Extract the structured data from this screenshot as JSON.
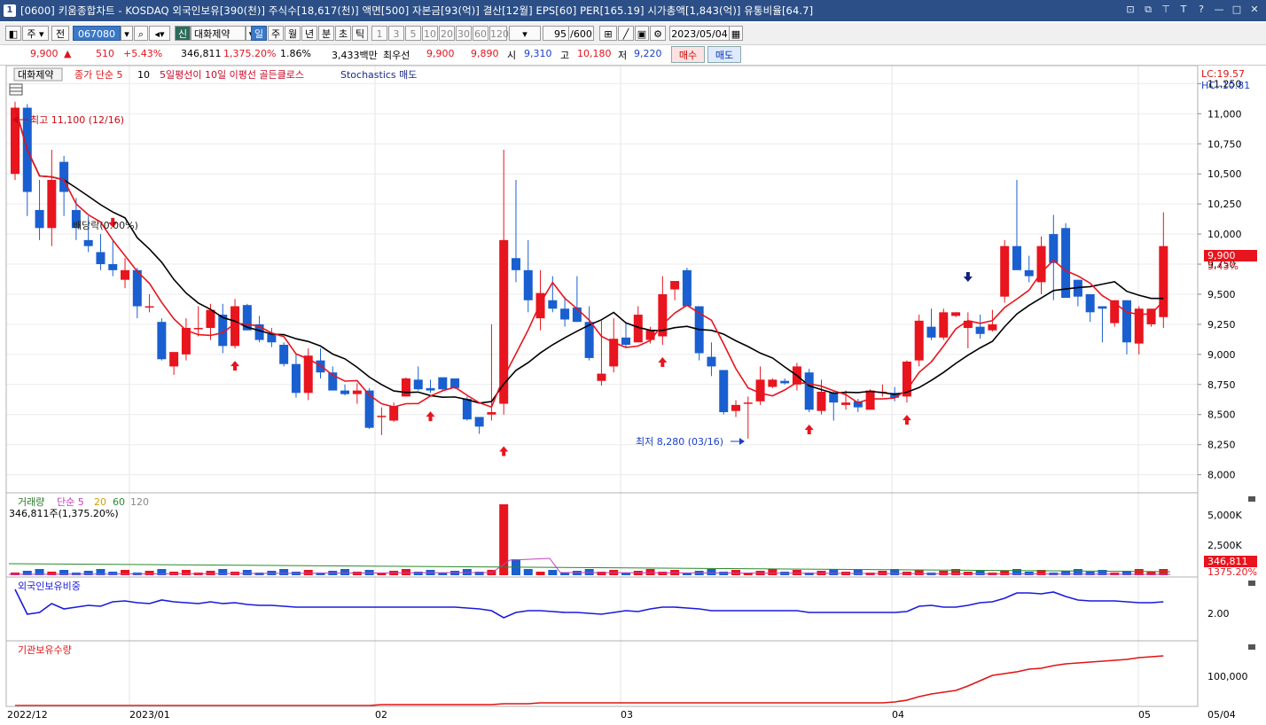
{
  "window": {
    "number": "1",
    "title": "[0600] 키움종합차트 - KOSDAQ 외국인보유[390(천)] 주식수[18,617(천)] 액면[500] 자본금[93(억)] 결산[12월] EPS[60] PER[165.19] 시가총액[1,843(억)] 유통비율[64.7]",
    "controls": [
      "⊡",
      "⧉",
      "⊤",
      "T",
      "?",
      "—",
      "□",
      "✕"
    ]
  },
  "toolbar": {
    "period_label": "주",
    "prev_label": "전",
    "code": "067080",
    "stock_tag": "신",
    "stock_name": "대화제약",
    "intervals": [
      "일",
      "주",
      "월",
      "년",
      "분",
      "초",
      "틱"
    ],
    "selected_interval": "일",
    "minute_options": [
      "1",
      "3",
      "5",
      "10",
      "20",
      "30",
      "60",
      "120"
    ],
    "count": "95",
    "count_max": "/600",
    "date": "2023/05/04"
  },
  "quote": {
    "price": "9,900",
    "change": "510",
    "change_pct": "+5.43%",
    "volume": "346,811",
    "volume_ratio": "1,375.20%",
    "turnover": "1.86%",
    "amount": "3,433백만",
    "best_label": "최우선",
    "ask": "9,900",
    "bid": "9,890",
    "open_label": "시",
    "open": "9,310",
    "high_label": "고",
    "high": "10,180",
    "low_label": "저",
    "low": "9,220",
    "buy_label": "매수",
    "sell_label": "매도"
  },
  "price_panel": {
    "name_tag": "대화제약",
    "legend_close": "종가 단순 5",
    "legend_ma10": "10",
    "legend_cross": "5일평선이 10일 이평선 골든클로스",
    "legend_stoch": "Stochastics 매도",
    "lc": "LC:19.57",
    "hc": "HC:-10.81",
    "high_annotation": "최고 11,100 (12/16)",
    "low_annotation": "최저 8,280 (03/16)",
    "dividend_annotation": "배당락(0.00%)",
    "last_price_tag": "9,900",
    "last_pct_tag": "5.43%",
    "y_ticks": [
      "11,250",
      "11,000",
      "10,750",
      "10,500",
      "10,250",
      "10,000",
      "9,750",
      "9,500",
      "9,250",
      "9,000",
      "8,750",
      "8,500",
      "8,250",
      "8,000"
    ]
  },
  "volume_panel": {
    "title": "거래량",
    "ma_label": "단순 5",
    "ma20": "20",
    "ma60": "60",
    "ma120": "120",
    "value_label": "346,811주(1,375.20%)",
    "y_ticks": [
      "5,000K",
      "2,500K"
    ],
    "tag_value": "346,811",
    "tag_pct": "1375.20%"
  },
  "foreign_panel": {
    "title": "외국인보유비중",
    "y_tick": "2.00"
  },
  "inst_panel": {
    "title": "기관보유수량",
    "y_tick": "100,000"
  },
  "x_axis": {
    "labels": [
      "2022/12",
      "2023/01",
      "02",
      "03",
      "04",
      "05"
    ],
    "right_label": "05/04"
  },
  "colors": {
    "up": "#e8141e",
    "down": "#1a5fd0",
    "ma5": "#e8141e",
    "ma10": "#000000",
    "foreign_line": "#1a1adc",
    "inst_line": "#e01414",
    "titlebar": "#2b4f86"
  },
  "chart_data": {
    "type": "candlestick",
    "ylim": [
      7850,
      11400
    ],
    "candles": [
      {
        "o": 10500,
        "h": 11100,
        "l": 10450,
        "c": 11050
      },
      {
        "o": 11050,
        "h": 11080,
        "l": 10150,
        "c": 10350
      },
      {
        "o": 10200,
        "h": 10450,
        "l": 9950,
        "c": 10050
      },
      {
        "o": 10050,
        "h": 10700,
        "l": 9900,
        "c": 10450
      },
      {
        "o": 10600,
        "h": 10650,
        "l": 10150,
        "c": 10350
      },
      {
        "o": 10200,
        "h": 10300,
        "l": 9950,
        "c": 10050
      },
      {
        "o": 9950,
        "h": 10150,
        "l": 9850,
        "c": 9900
      },
      {
        "o": 9850,
        "h": 10000,
        "l": 9700,
        "c": 9750
      },
      {
        "o": 9750,
        "h": 9950,
        "l": 9650,
        "c": 9700
      },
      {
        "o": 9620,
        "h": 9800,
        "l": 9550,
        "c": 9700
      },
      {
        "o": 9700,
        "h": 9720,
        "l": 9300,
        "c": 9400
      },
      {
        "o": 9400,
        "h": 9500,
        "l": 9350,
        "c": 9400
      },
      {
        "o": 9270,
        "h": 9300,
        "l": 8950,
        "c": 8960
      },
      {
        "o": 8900,
        "h": 9000,
        "l": 8830,
        "c": 9020
      },
      {
        "o": 9000,
        "h": 9300,
        "l": 8950,
        "c": 9220
      },
      {
        "o": 9220,
        "h": 9400,
        "l": 9150,
        "c": 9220
      },
      {
        "o": 9220,
        "h": 9420,
        "l": 9120,
        "c": 9370
      },
      {
        "o": 9330,
        "h": 9420,
        "l": 9010,
        "c": 9070
      },
      {
        "o": 9070,
        "h": 9460,
        "l": 9050,
        "c": 9400
      },
      {
        "o": 9410,
        "h": 9420,
        "l": 9200,
        "c": 9200
      },
      {
        "o": 9250,
        "h": 9320,
        "l": 9100,
        "c": 9120
      },
      {
        "o": 9170,
        "h": 9220,
        "l": 9060,
        "c": 9100
      },
      {
        "o": 9080,
        "h": 9100,
        "l": 8900,
        "c": 8920
      },
      {
        "o": 8920,
        "h": 9010,
        "l": 8640,
        "c": 8680
      },
      {
        "o": 8680,
        "h": 9050,
        "l": 8620,
        "c": 8990
      },
      {
        "o": 8950,
        "h": 9050,
        "l": 8800,
        "c": 8850
      },
      {
        "o": 8850,
        "h": 8900,
        "l": 8700,
        "c": 8700
      },
      {
        "o": 8700,
        "h": 8750,
        "l": 8660,
        "c": 8670
      },
      {
        "o": 8670,
        "h": 8760,
        "l": 8590,
        "c": 8700
      },
      {
        "o": 8700,
        "h": 8720,
        "l": 8380,
        "c": 8390
      },
      {
        "o": 8480,
        "h": 8560,
        "l": 8330,
        "c": 8490
      },
      {
        "o": 8450,
        "h": 8600,
        "l": 8440,
        "c": 8570
      },
      {
        "o": 8650,
        "h": 8810,
        "l": 8650,
        "c": 8800
      },
      {
        "o": 8790,
        "h": 8900,
        "l": 8700,
        "c": 8710
      },
      {
        "o": 8720,
        "h": 8790,
        "l": 8680,
        "c": 8700
      },
      {
        "o": 8810,
        "h": 8800,
        "l": 8700,
        "c": 8710
      },
      {
        "o": 8800,
        "h": 8800,
        "l": 8710,
        "c": 8720
      },
      {
        "o": 8630,
        "h": 8650,
        "l": 8450,
        "c": 8460
      },
      {
        "o": 8480,
        "h": 8450,
        "l": 8340,
        "c": 8400
      },
      {
        "o": 8500,
        "h": 9250,
        "l": 8450,
        "c": 8520
      },
      {
        "o": 8590,
        "h": 10700,
        "l": 8500,
        "c": 9950
      },
      {
        "o": 9800,
        "h": 10450,
        "l": 9600,
        "c": 9700
      },
      {
        "o": 9700,
        "h": 9950,
        "l": 9350,
        "c": 9450
      },
      {
        "o": 9300,
        "h": 9700,
        "l": 9200,
        "c": 9510
      },
      {
        "o": 9450,
        "h": 9650,
        "l": 9350,
        "c": 9380
      },
      {
        "o": 9380,
        "h": 9480,
        "l": 9230,
        "c": 9290
      },
      {
        "o": 9390,
        "h": 9650,
        "l": 9270,
        "c": 9270
      },
      {
        "o": 9270,
        "h": 9400,
        "l": 8950,
        "c": 8970
      },
      {
        "o": 8780,
        "h": 9280,
        "l": 8740,
        "c": 8840
      },
      {
        "o": 8900,
        "h": 9300,
        "l": 8850,
        "c": 9130
      },
      {
        "o": 9140,
        "h": 9270,
        "l": 9060,
        "c": 9080
      },
      {
        "o": 9100,
        "h": 9400,
        "l": 9100,
        "c": 9330
      },
      {
        "o": 9120,
        "h": 9230,
        "l": 9090,
        "c": 9200
      },
      {
        "o": 9150,
        "h": 9650,
        "l": 9080,
        "c": 9500
      },
      {
        "o": 9540,
        "h": 9590,
        "l": 9450,
        "c": 9610
      },
      {
        "o": 9700,
        "h": 9720,
        "l": 9420,
        "c": 9400
      },
      {
        "o": 9400,
        "h": 9400,
        "l": 8950,
        "c": 9010
      },
      {
        "o": 8980,
        "h": 9100,
        "l": 8820,
        "c": 8900
      },
      {
        "o": 8870,
        "h": 8850,
        "l": 8500,
        "c": 8520
      },
      {
        "o": 8530,
        "h": 8620,
        "l": 8480,
        "c": 8580
      },
      {
        "o": 8600,
        "h": 8650,
        "l": 8300,
        "c": 8600
      },
      {
        "o": 8610,
        "h": 8900,
        "l": 8580,
        "c": 8790
      },
      {
        "o": 8730,
        "h": 8800,
        "l": 8720,
        "c": 8790
      },
      {
        "o": 8780,
        "h": 8800,
        "l": 8750,
        "c": 8760
      },
      {
        "o": 8750,
        "h": 8930,
        "l": 8700,
        "c": 8900
      },
      {
        "o": 8850,
        "h": 8880,
        "l": 8520,
        "c": 8540
      },
      {
        "o": 8530,
        "h": 8790,
        "l": 8500,
        "c": 8690
      },
      {
        "o": 8680,
        "h": 8700,
        "l": 8450,
        "c": 8600
      },
      {
        "o": 8580,
        "h": 8700,
        "l": 8540,
        "c": 8600
      },
      {
        "o": 8610,
        "h": 8630,
        "l": 8520,
        "c": 8560
      },
      {
        "o": 8540,
        "h": 8710,
        "l": 8540,
        "c": 8700
      },
      {
        "o": 8690,
        "h": 8750,
        "l": 8650,
        "c": 8690
      },
      {
        "o": 8680,
        "h": 8730,
        "l": 8610,
        "c": 8640
      },
      {
        "o": 8650,
        "h": 8950,
        "l": 8600,
        "c": 8940
      },
      {
        "o": 8950,
        "h": 9330,
        "l": 8900,
        "c": 9280
      },
      {
        "o": 9230,
        "h": 9380,
        "l": 9120,
        "c": 9140
      },
      {
        "o": 9140,
        "h": 9380,
        "l": 9120,
        "c": 9350
      },
      {
        "o": 9320,
        "h": 9350,
        "l": 9310,
        "c": 9350
      },
      {
        "o": 9220,
        "h": 9350,
        "l": 9050,
        "c": 9280
      },
      {
        "o": 9230,
        "h": 9330,
        "l": 9130,
        "c": 9170
      },
      {
        "o": 9200,
        "h": 9370,
        "l": 9190,
        "c": 9250
      },
      {
        "o": 9480,
        "h": 9950,
        "l": 9430,
        "c": 9900
      },
      {
        "o": 9900,
        "h": 10450,
        "l": 9800,
        "c": 9700
      },
      {
        "o": 9700,
        "h": 9820,
        "l": 9600,
        "c": 9650
      },
      {
        "o": 9600,
        "h": 9980,
        "l": 9500,
        "c": 9900
      },
      {
        "o": 10000,
        "h": 10160,
        "l": 9450,
        "c": 9760
      },
      {
        "o": 10050,
        "h": 10090,
        "l": 9500,
        "c": 9470
      },
      {
        "o": 9620,
        "h": 9620,
        "l": 9400,
        "c": 9480
      },
      {
        "o": 9500,
        "h": 9500,
        "l": 9270,
        "c": 9350
      },
      {
        "o": 9400,
        "h": 9400,
        "l": 9100,
        "c": 9380
      },
      {
        "o": 9260,
        "h": 9450,
        "l": 9230,
        "c": 9450
      },
      {
        "o": 9450,
        "h": 9450,
        "l": 9000,
        "c": 9100
      },
      {
        "o": 9090,
        "h": 9400,
        "l": 9000,
        "c": 9380
      },
      {
        "o": 9250,
        "h": 9350,
        "l": 9230,
        "c": 9380
      },
      {
        "o": 9310,
        "h": 10180,
        "l": 9220,
        "c": 9900
      }
    ]
  }
}
